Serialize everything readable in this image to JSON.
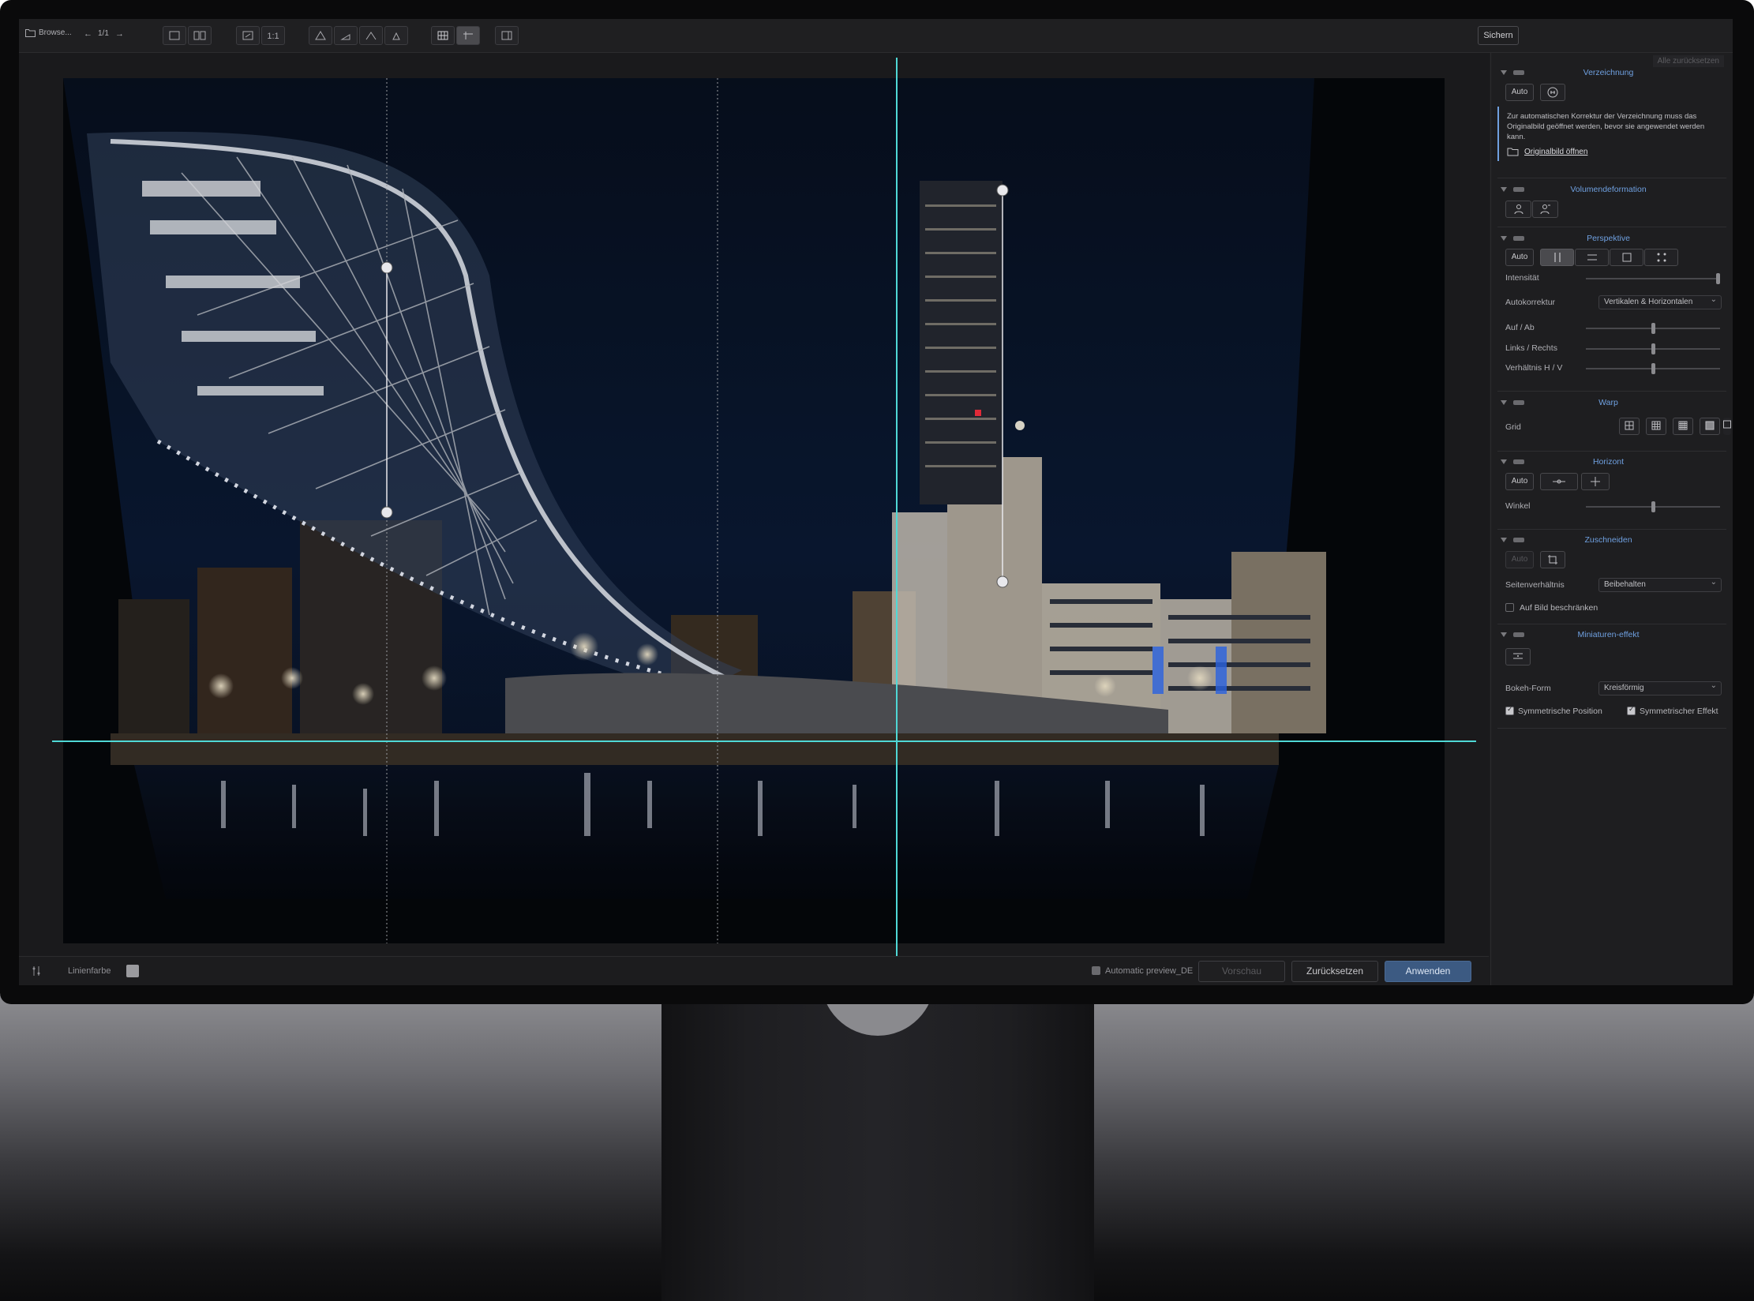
{
  "toolbar": {
    "browse_label": "Browse...",
    "page_indicator": "1/1",
    "zoom_1to1": "1:1",
    "save_label": "Sichern"
  },
  "panel": {
    "reset_all": "Alle zurücksetzen",
    "verzeichnung": {
      "title": "Verzeichnung",
      "auto_label": "Auto",
      "note": "Zur automatischen Korrektur der Verzeichnung muss das Originalbild geöffnet werden, bevor sie angewendet werden kann.",
      "open_original": "Originalbild öffnen"
    },
    "volumendeformation": {
      "title": "Volumendeformation"
    },
    "perspektive": {
      "title": "Perspektive",
      "auto_label": "Auto",
      "intensity_label": "Intensität",
      "intensity_value": 1.0,
      "autocorrect_label": "Autokorrektur",
      "autocorrect_value": "Vertikalen & Horizontalen",
      "up_down_label": "Auf / Ab",
      "up_down_value": 0.5,
      "left_right_label": "Links / Rechts",
      "left_right_value": 0.5,
      "ratio_label": "Verhältnis H / V",
      "ratio_value": 0.5
    },
    "warp": {
      "title": "Warp",
      "grid_label": "Grid"
    },
    "horizont": {
      "title": "Horizont",
      "auto_label": "Auto",
      "angle_label": "Winkel",
      "angle_value": 0.5
    },
    "zuschneiden": {
      "title": "Zuschneiden",
      "auto_label": "Auto",
      "aspect_label": "Seitenverhältnis",
      "aspect_value": "Beibehalten",
      "limit_label": "Auf Bild beschränken",
      "limit_checked": false
    },
    "miniaturen": {
      "title": "Miniaturen-effekt",
      "bokeh_label": "Bokeh-Form",
      "bokeh_value": "Kreisförmig",
      "sym_position_label": "Symmetrische Position",
      "sym_position_checked": true,
      "sym_effect_label": "Symmetrischer Effekt",
      "sym_effect_checked": true
    }
  },
  "bottom": {
    "line_color_label": "Linienfarbe",
    "auto_preview_label": "Automatic preview_DE",
    "preview_label": "Vorschau",
    "reset_label": "Zurücksetzen",
    "apply_label": "Anwenden"
  },
  "colors": {
    "guide_line": "#4fd8d6",
    "accent": "#6fa0e0",
    "apply_button": "#3c5a82"
  }
}
